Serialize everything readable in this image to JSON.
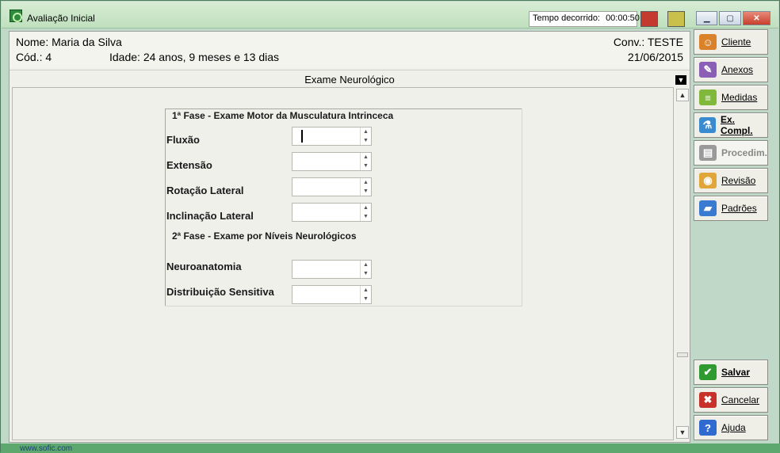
{
  "window": {
    "title": "Avaliação Inicial",
    "timer_label": "Tempo decorrido:",
    "timer_value": "00:00:50"
  },
  "patient": {
    "name": "Nome: Maria da Silva",
    "cod": "Cód.:  4",
    "age": "Idade: 24 anos, 9 meses e 13 dias",
    "conv": "Conv.: TESTE",
    "date": "21/06/2015"
  },
  "section": {
    "title": "Exame Neurológico"
  },
  "form": {
    "fase1": "1ª Fase - Exame Motor da Musculatura Intrinceca",
    "fase2": "2ª Fase - Exame por Níveis Neurológicos",
    "fields": [
      {
        "label": "Fluxão",
        "value": ""
      },
      {
        "label": "Extensão",
        "value": ""
      },
      {
        "label": "Rotação Lateral",
        "value": ""
      },
      {
        "label": "Inclinação Lateral",
        "value": ""
      },
      {
        "label": "Neuroanatomia",
        "value": ""
      },
      {
        "label": "Distribuição Sensitiva",
        "value": ""
      }
    ]
  },
  "sidebar": {
    "buttons": [
      {
        "label": "Cliente",
        "icon": "users-icon",
        "color": "#d9822b"
      },
      {
        "label": "Anexos",
        "icon": "attachment-icon",
        "color": "#8a5fb5"
      },
      {
        "label": "Medidas",
        "icon": "measure-icon",
        "color": "#7fb83a"
      },
      {
        "label": "Ex. Compl.",
        "icon": "lab-flask-icon",
        "color": "#3a8ad0"
      },
      {
        "label": "Procedim.",
        "icon": "procedure-icon",
        "color": "#9a9a9a"
      },
      {
        "label": "Revisão",
        "icon": "review-folder-icon",
        "color": "#e0a63a"
      },
      {
        "label": "Padrões",
        "icon": "book-icon",
        "color": "#3a7ad0"
      }
    ],
    "actions": [
      {
        "label": "Salvar",
        "icon": "check-icon",
        "color": "#2f9a2f"
      },
      {
        "label": "Cancelar",
        "icon": "cross-icon",
        "color": "#c8302a"
      },
      {
        "label": "Ajuda",
        "icon": "help-icon",
        "color": "#2f6ad0"
      }
    ]
  },
  "footer": {
    "text": "www.sofic.com"
  }
}
